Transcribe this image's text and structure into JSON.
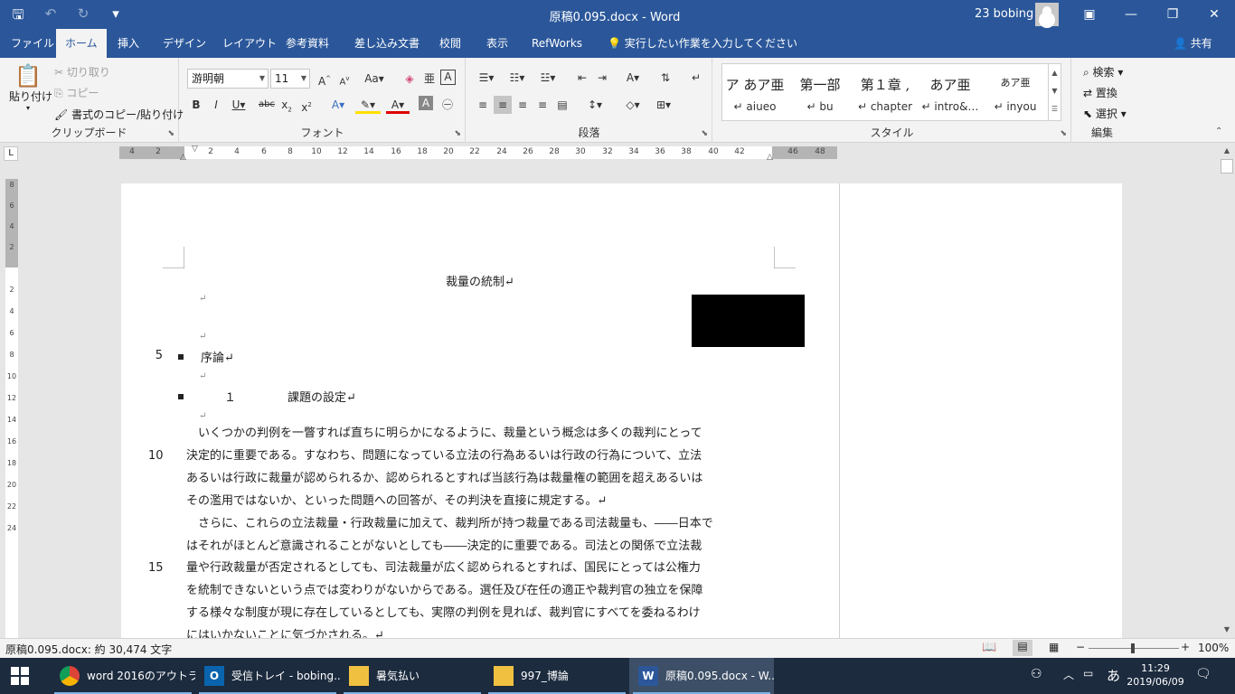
{
  "window": {
    "title": "原稿0.095.docx  -  Word",
    "user": "23 bobing",
    "minimize_icon": "—",
    "restore_icon": "❐",
    "close_icon": "✕",
    "ribbon_display_icon": "▣"
  },
  "tabs": [
    "ファイル",
    "ホーム",
    "挿入",
    "デザイン",
    "レイアウト",
    "参考資料",
    "差し込み文書",
    "校閲",
    "表示",
    "RefWorks"
  ],
  "tell_me": "実行したい作業を入力してください",
  "share": "共有",
  "clipboard": {
    "paste": "貼り付け",
    "cut": "切り取り",
    "copy": "コピー",
    "format_painter": "書式のコピー/貼り付け",
    "label": "クリップボード"
  },
  "font": {
    "name": "游明朝",
    "size": "11",
    "label": "フォント"
  },
  "paragraph": {
    "label": "段落"
  },
  "styles": {
    "label": "スタイル",
    "items": [
      {
        "sample": "ア あア亜",
        "name": "↵ aiueo"
      },
      {
        "sample": "第一部",
        "name": "↵ bu"
      },
      {
        "sample": "第１章 ,",
        "name": "↵ chapter"
      },
      {
        "sample": "あア亜",
        "name": "↵ intro&…"
      },
      {
        "sample": "あア亜",
        "name": "↵ inyou"
      }
    ]
  },
  "editing": {
    "find": "検索",
    "replace": "置換",
    "select": "選択",
    "label": "編集"
  },
  "ruler": {
    "numbers": [
      "4",
      "2",
      "2",
      "4",
      "6",
      "8",
      "10",
      "12",
      "14",
      "16",
      "18",
      "20",
      "22",
      "24",
      "26",
      "28",
      "30",
      "32",
      "34",
      "36",
      "38",
      "40",
      "42",
      "46",
      "48"
    ],
    "vertical_numbers": [
      "8",
      "6",
      "4",
      "2",
      "2",
      "4",
      "6",
      "8",
      "10",
      "12",
      "14",
      "16",
      "18",
      "20",
      "22",
      "24"
    ]
  },
  "document": {
    "title": "裁量の統制↵",
    "para_mark": "↵",
    "heading1": "序論↵",
    "heading2_num": "１",
    "heading2_text": "課題の設定↵",
    "line_numbers": [
      "5",
      "10",
      "15"
    ],
    "body_lines": [
      "　いくつかの判例を一瞥すれば直ちに明らかになるように、裁量という概念は多くの裁判にとって",
      "決定的に重要である。すなわち、問題になっている立法の行為あるいは行政の行為について、立法",
      "あるいは行政に裁量が認められるか、認められるとすれば当該行為は裁量権の範囲を超えあるいは",
      "その濫用ではないか、といった問題への回答が、その判決を直接に規定する。↵",
      "　さらに、これらの立法裁量・行政裁量に加えて、裁判所が持つ裁量である司法裁量も、――日本で",
      "はそれがほとんど意識されることがないとしても――決定的に重要である。司法との関係で立法裁",
      "量や行政裁量が否定されるとしても、司法裁量が広く認められるとすれば、国民にとっては公権力",
      "を統制できないという点では変わりがないからである。選任及び在任の適正や裁判官の独立を保障",
      "する様々な制度が現に存在しているとしても、実際の判例を見れば、裁判官にすべてを委ねるわけ",
      "にはいかないことに気づかされる。↵"
    ]
  },
  "status": {
    "info": "原稿0.095.docx: 約 30,474 文字",
    "zoom": "100%",
    "zoom_level": 100,
    "zoom_minus": "−",
    "zoom_plus": "+"
  },
  "taskbar": {
    "items": [
      "word 2016のアウトラ...",
      "受信トレイ - bobing...",
      "暑気払い",
      "997_博論",
      "原稿0.095.docx - W..."
    ],
    "ime": "あ",
    "time": "11:29",
    "date": "2019/06/09"
  },
  "colors": {
    "accent": "#2b579a",
    "taskbar": "#1c2b3e"
  }
}
